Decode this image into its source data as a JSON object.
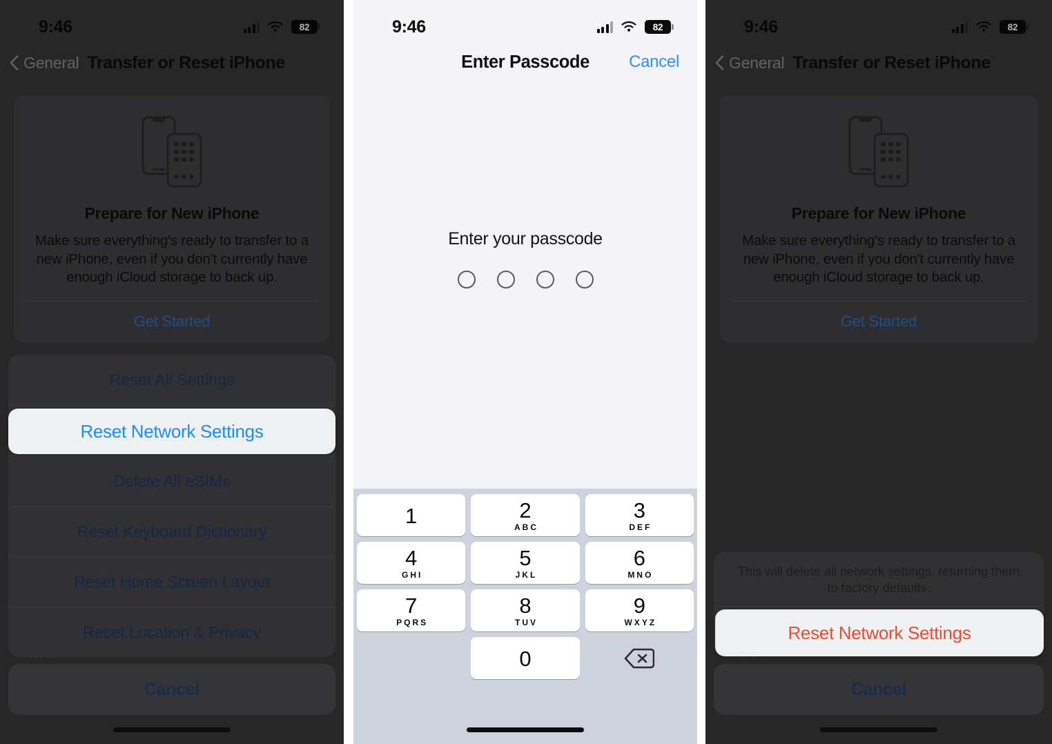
{
  "status_bar": {
    "time": "9:46",
    "battery_percent": "82",
    "signal_icon": "cellular-signal-icon",
    "wifi_icon": "wifi-icon",
    "battery_icon": "battery-icon"
  },
  "panel1": {
    "nav": {
      "back_label": "General",
      "back_icon": "chevron-left-icon",
      "title": "Transfer or Reset iPhone"
    },
    "prepare_card": {
      "illustration_icon": "two-iphones-icon",
      "title": "Prepare for New iPhone",
      "description": "Make sure everything's ready to transfer to a new iPhone, even if you don't currently have enough iCloud storage to back up.",
      "cta_label": "Get Started"
    },
    "action_sheet": {
      "options": [
        "Reset All Settings",
        "Reset Network Settings",
        "Delete All eSIMs",
        "Reset Keyboard Dictionary",
        "Reset Home Screen Layout",
        "Reset Location & Privacy"
      ],
      "highlighted_option": "Reset Network Settings",
      "ghost_label": "Reset",
      "cancel_label": "Cancel"
    }
  },
  "panel2": {
    "header": {
      "title": "Enter Passcode",
      "cancel_label": "Cancel"
    },
    "prompt": "Enter your passcode",
    "dot_count": 4,
    "keypad": {
      "keys": [
        {
          "num": "1",
          "letters": ""
        },
        {
          "num": "2",
          "letters": "ABC"
        },
        {
          "num": "3",
          "letters": "DEF"
        },
        {
          "num": "4",
          "letters": "GHI"
        },
        {
          "num": "5",
          "letters": "JKL"
        },
        {
          "num": "6",
          "letters": "MNO"
        },
        {
          "num": "7",
          "letters": "PQRS"
        },
        {
          "num": "8",
          "letters": "TUV"
        },
        {
          "num": "9",
          "letters": "WXYZ"
        },
        {
          "num": "0",
          "letters": ""
        }
      ],
      "delete_icon": "backspace-delete-icon"
    }
  },
  "panel3": {
    "nav": {
      "back_label": "General",
      "back_icon": "chevron-left-icon",
      "title": "Transfer or Reset iPhone"
    },
    "prepare_card": {
      "illustration_icon": "two-iphones-icon",
      "title": "Prepare for New iPhone",
      "description": "Make sure everything's ready to transfer to a new iPhone, even if you don't currently have enough iCloud storage to back up.",
      "cta_label": "Get Started"
    },
    "confirm_sheet": {
      "message": "This will delete all network settings, returning them to factory defaults.",
      "destructive_label": "Reset Network Settings",
      "ghost_label": "Reset",
      "cancel_label": "Cancel"
    }
  },
  "colors": {
    "ios_blue": "#1a8cff",
    "destructive_red": "#f2492f",
    "dim_overlay": "rgba(0,0,0,0.30)",
    "keypad_bg": "#ced2dd",
    "dark_screen_bg": "#38383a",
    "light_screen_bg": "#f4f4f7"
  }
}
